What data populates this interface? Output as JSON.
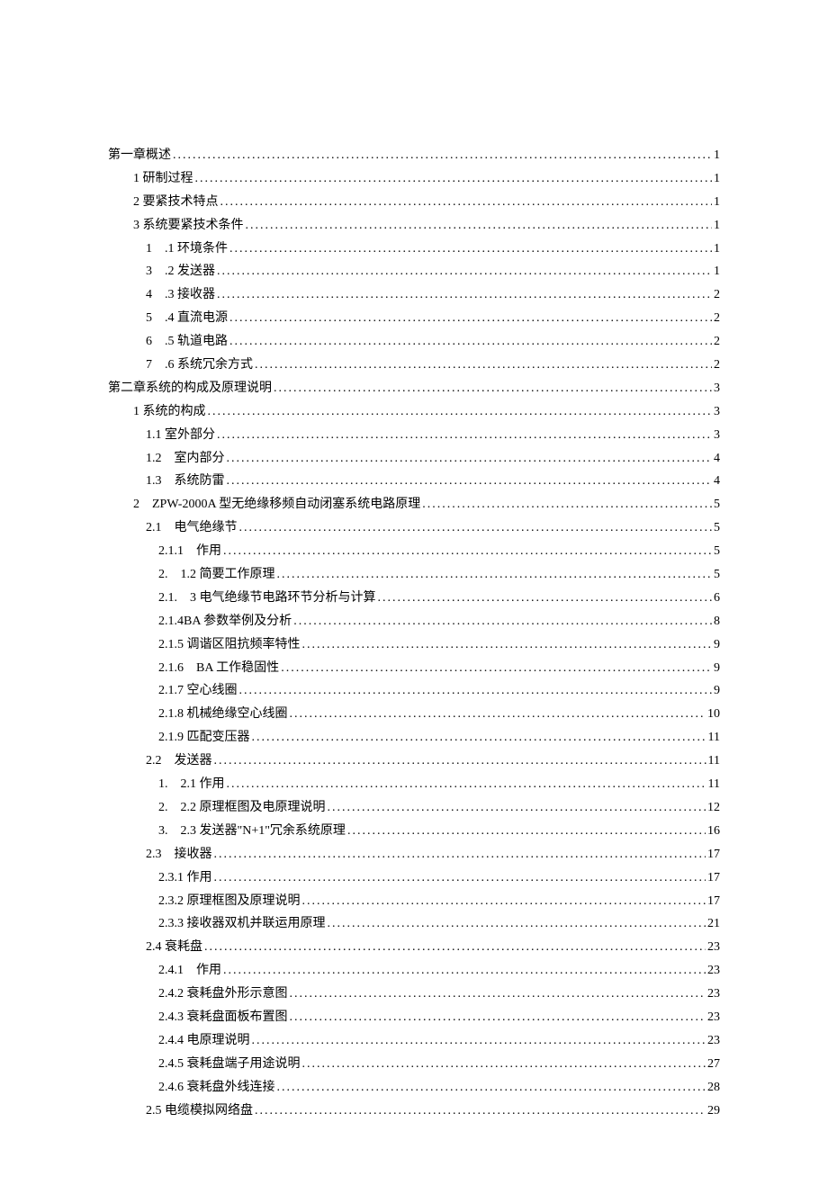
{
  "toc": [
    {
      "level": 0,
      "label": "第一章概述",
      "page": "1"
    },
    {
      "level": 1,
      "label": "1 研制过程",
      "page": "1"
    },
    {
      "level": 1,
      "label": "2 要紧技术特点",
      "page": "1"
    },
    {
      "level": 1,
      "label": "3 系统要紧技术条件",
      "page": "1"
    },
    {
      "level": 2,
      "label": "1　.1 环境条件",
      "page": "1"
    },
    {
      "level": 2,
      "label": "3　.2 发送器",
      "page": "1"
    },
    {
      "level": 2,
      "label": "4　.3 接收器",
      "page": "2"
    },
    {
      "level": 2,
      "label": "5　.4 直流电源",
      "page": "2"
    },
    {
      "level": 2,
      "label": "6　.5 轨道电路",
      "page": "2"
    },
    {
      "level": 2,
      "label": "7　.6 系统冗余方式",
      "page": "2"
    },
    {
      "level": 0,
      "label": "第二章系统的构成及原理说明",
      "page": "3"
    },
    {
      "level": 1,
      "label": "1 系统的构成",
      "page": "3"
    },
    {
      "level": 2,
      "label": "1.1 室外部分",
      "page": "3"
    },
    {
      "level": 2,
      "label": "1.2　室内部分",
      "page": "4"
    },
    {
      "level": 2,
      "label": "1.3　系统防雷",
      "page": "4"
    },
    {
      "level": 1,
      "label": "2　ZPW-2000A 型无绝缘移频自动闭塞系统电路原理",
      "page": "5"
    },
    {
      "level": 2,
      "label": "2.1　电气绝缘节",
      "page": "5"
    },
    {
      "level": 3,
      "label": "2.1.1　作用",
      "page": "5"
    },
    {
      "level": 3,
      "label": "2.　1.2 简要工作原理",
      "page": "5"
    },
    {
      "level": 3,
      "label": "2.1.　3 电气绝缘节电路环节分析与计算",
      "page": "6"
    },
    {
      "level": 3,
      "label": "2.1.4BA 参数举例及分析",
      "page": "8"
    },
    {
      "level": 3,
      "label": "2.1.5 调谐区阻抗频率特性",
      "page": "9"
    },
    {
      "level": 3,
      "label": "2.1.6　BA 工作稳固性",
      "page": "9"
    },
    {
      "level": 3,
      "label": "2.1.7 空心线圈",
      "page": "9"
    },
    {
      "level": 3,
      "label": "2.1.8 机械绝缘空心线圈",
      "page": "10"
    },
    {
      "level": 3,
      "label": "2.1.9 匹配变压器",
      "page": "11"
    },
    {
      "level": 2,
      "label": "2.2　发送器",
      "page": "11"
    },
    {
      "level": 3,
      "label": "1.　2.1 作用",
      "page": "11"
    },
    {
      "level": 3,
      "label": "2.　2.2 原理框图及电原理说明",
      "page": "12"
    },
    {
      "level": 3,
      "label": "3.　2.3 发送器\"N+1\"冗余系统原理",
      "page": "16"
    },
    {
      "level": 2,
      "label": "2.3　接收器",
      "page": "17"
    },
    {
      "level": 3,
      "label": "2.3.1 作用",
      "page": "17"
    },
    {
      "level": 3,
      "label": "2.3.2 原理框图及原理说明",
      "page": "17"
    },
    {
      "level": 3,
      "label": "2.3.3 接收器双机并联运用原理",
      "page": "21"
    },
    {
      "level": 2,
      "label": "2.4 衰耗盘",
      "page": "23"
    },
    {
      "level": 3,
      "label": "2.4.1　作用",
      "page": "23"
    },
    {
      "level": 3,
      "label": "2.4.2 衰耗盘外形示意图",
      "page": "23"
    },
    {
      "level": 3,
      "label": "2.4.3 衰耗盘面板布置图",
      "page": "23"
    },
    {
      "level": 3,
      "label": "2.4.4 电原理说明",
      "page": "23"
    },
    {
      "level": 3,
      "label": "2.4.5 衰耗盘端子用途说明",
      "page": "27"
    },
    {
      "level": 3,
      "label": "2.4.6 衰耗盘外线连接",
      "page": "28"
    },
    {
      "level": 2,
      "label": "2.5 电缆模拟网络盘",
      "page": "29"
    }
  ]
}
